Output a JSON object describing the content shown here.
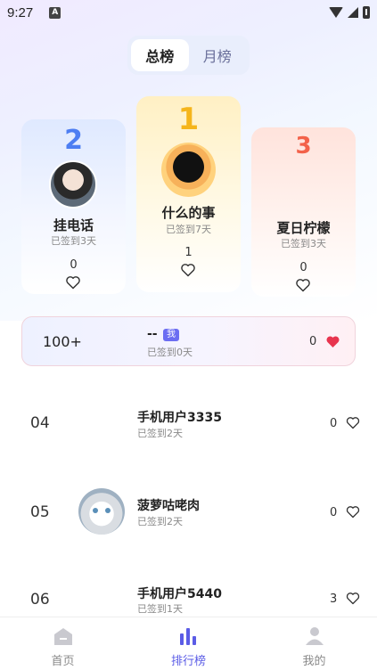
{
  "status_bar": {
    "time": "9:27",
    "notice_icon": "A"
  },
  "tabs": [
    {
      "label": "总榜",
      "active": true
    },
    {
      "label": "月榜",
      "active": false
    }
  ],
  "podium": [
    {
      "rank": "2",
      "name": "挂电话",
      "sub": "已签到3天",
      "count": "0"
    },
    {
      "rank": "1",
      "name": "什么的事",
      "sub": "已签到7天",
      "count": "1"
    },
    {
      "rank": "3",
      "name": "夏日柠檬",
      "sub": "已签到3天",
      "count": "0"
    }
  ],
  "my_rank": {
    "rank": "100+",
    "name": "--",
    "badge": "我",
    "sub": "已签到0天",
    "count": "0"
  },
  "list": [
    {
      "rank": "04",
      "name": "手机用户3335",
      "sub": "已签到2天",
      "count": "0"
    },
    {
      "rank": "05",
      "name": "菠萝咕咾肉",
      "sub": "已签到2天",
      "count": "0"
    },
    {
      "rank": "06",
      "name": "手机用户5440",
      "sub": "已签到1天",
      "count": "3"
    }
  ],
  "bottom_nav": [
    {
      "label": "首页",
      "icon": "home-icon"
    },
    {
      "label": "排行榜",
      "icon": "ranking-icon",
      "active": true
    },
    {
      "label": "我的",
      "icon": "profile-icon"
    }
  ],
  "colors": {
    "accent": "#5b5ce6",
    "heart_filled": "#e8344e",
    "gold": "#f5b51c",
    "silver": "#4d7ef2",
    "bronze": "#f3624a"
  }
}
